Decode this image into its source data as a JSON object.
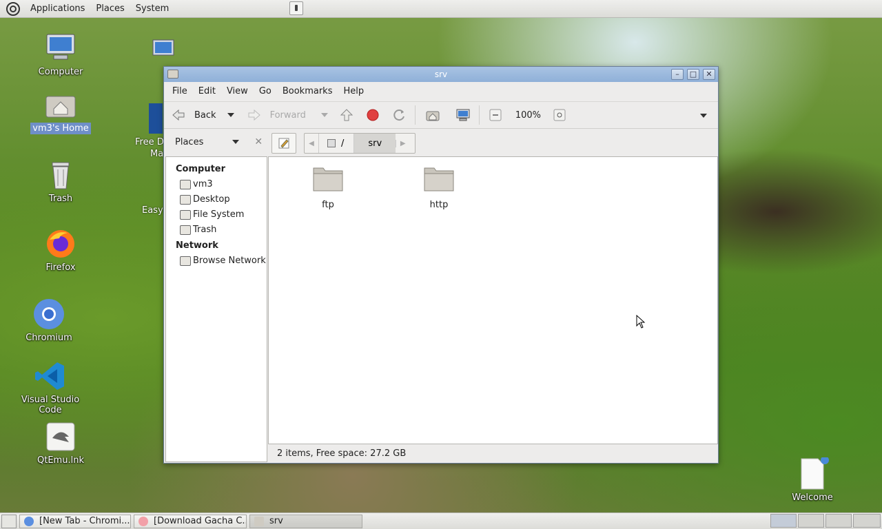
{
  "top_panel": {
    "menus": [
      "Applications",
      "Places",
      "System"
    ]
  },
  "desktop_icons": [
    {
      "label": "Computer",
      "icon": "computer-icon"
    },
    {
      "label": "vm3's Home",
      "icon": "home-folder-icon"
    },
    {
      "label": "Trash",
      "icon": "trash-icon"
    },
    {
      "label": "Firefox",
      "icon": "firefox-icon"
    },
    {
      "label": "Chromium",
      "icon": "chromium-icon"
    },
    {
      "label": "Visual Studio Code",
      "icon": "vscode-icon"
    },
    {
      "label": "QtEmu.lnk",
      "icon": "qtemu-icon"
    },
    {
      "label": "Welcome",
      "icon": "document-icon"
    }
  ],
  "partial_desktop_labels": [
    "Free D",
    "Ma",
    "Easy"
  ],
  "window": {
    "title": "srv",
    "menus": [
      "File",
      "Edit",
      "View",
      "Go",
      "Bookmarks",
      "Help"
    ],
    "toolbar": {
      "back": "Back",
      "forward": "Forward",
      "zoom": "100%"
    },
    "sidebar": {
      "header": "Places",
      "sections": [
        {
          "title": "Computer",
          "items": [
            "vm3",
            "Desktop",
            "File System",
            "Trash"
          ]
        },
        {
          "title": "Network",
          "items": [
            "Browse Network"
          ]
        }
      ]
    },
    "path": {
      "root": "/",
      "current": "srv"
    },
    "items": [
      {
        "name": "ftp",
        "icon": "folder-icon"
      },
      {
        "name": "http",
        "icon": "folder-icon"
      }
    ],
    "status": "2 items, Free space: 27.2 GB"
  },
  "taskbar": {
    "tasks": [
      {
        "label": "[New Tab - Chromi...",
        "icon": "chromium-icon"
      },
      {
        "label": "[Download Gacha C...",
        "icon": "browser-icon"
      },
      {
        "label": "srv",
        "icon": "folder-icon"
      }
    ]
  }
}
